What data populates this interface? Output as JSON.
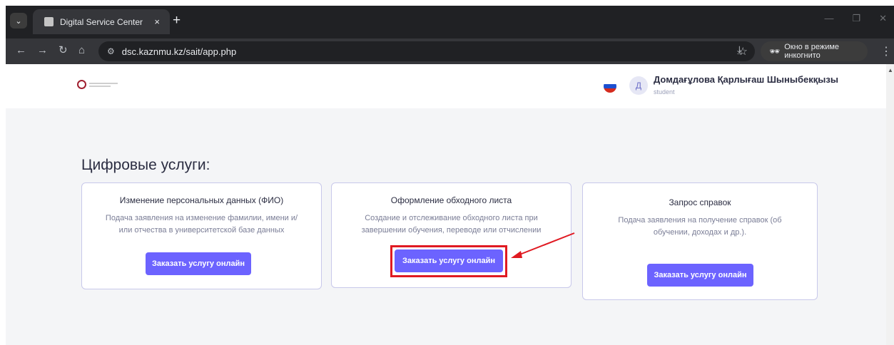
{
  "browser": {
    "tab_title": "Digital Service Center",
    "tab_close": "×",
    "new_tab": "+",
    "url": "dsc.kaznmu.kz/sait/app.php",
    "incognito_label": "Окно в режиме инкогнито"
  },
  "header": {
    "user_initial": "Д",
    "user_name": "Домдағұлова Қарлығаш Шыныбекқызы",
    "user_role": "student",
    "flag_colors": [
      "#ffffff",
      "#1c4fd0",
      "#d52b1e"
    ]
  },
  "main": {
    "heading": "Цифровые услуги:",
    "cards": [
      {
        "title": "Изменение персональных данных (ФИО)",
        "desc_line1": "Подача заявления на изменение фамилии, имени и/",
        "desc_line2": "или отчества в университетской базе данных",
        "button": "Заказать услугу онлайн"
      },
      {
        "title": "Оформление обходного листа",
        "desc_line1": "Создание и отслеживание обходного листа при",
        "desc_line2": "завершении обучения, переводе или отчислении",
        "button": "Заказать услугу онлайн"
      },
      {
        "title": "Запрос справок",
        "desc_line1": "Подача заявления на получение справок (об",
        "desc_line2": "обучении, доходах и др.).",
        "button": "Заказать услугу онлайн"
      }
    ]
  },
  "colors": {
    "accent": "#6c63ff",
    "highlight": "#e01a22",
    "card_border": "#c8c8ea"
  }
}
